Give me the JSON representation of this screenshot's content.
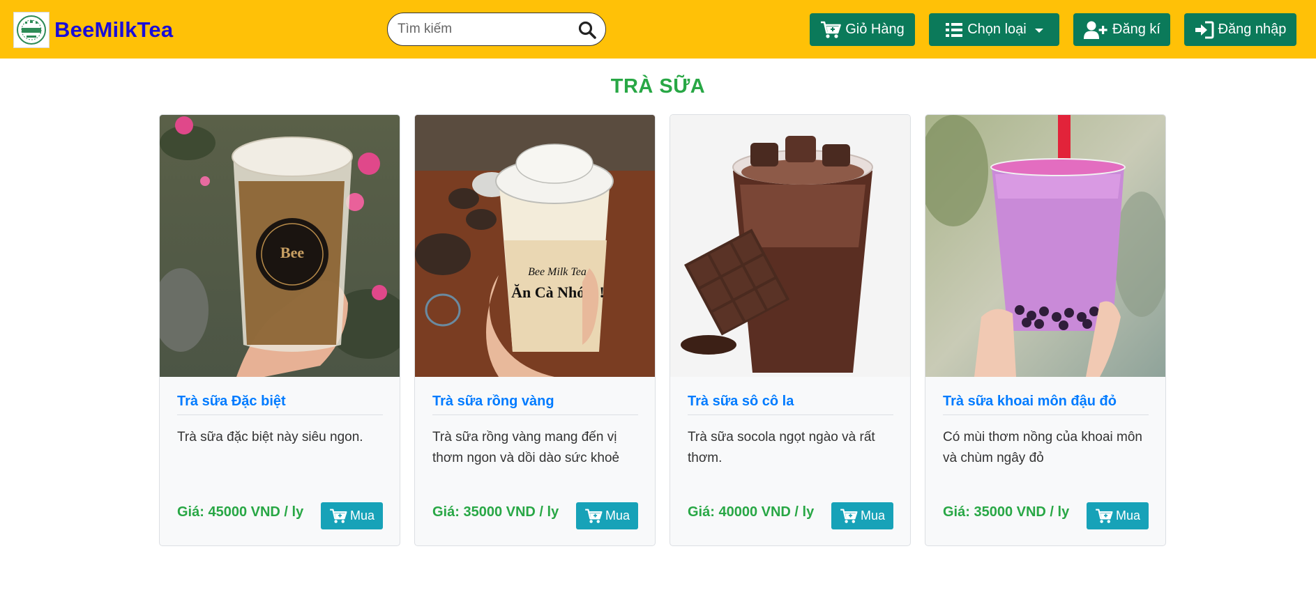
{
  "header": {
    "brand": {
      "name": "BeeMilkTea",
      "logo_icon": "bee-milk-tea-logo"
    },
    "search": {
      "placeholder": "Tìm kiếm",
      "value": "",
      "icon": "search-icon"
    },
    "buttons": {
      "cart": {
        "label": "Giỏ Hàng",
        "icon": "cart-plus-icon"
      },
      "category": {
        "label": "Chọn loại",
        "icon": "list-icon"
      },
      "register": {
        "label": "Đăng kí",
        "icon": "user-plus-icon"
      },
      "login": {
        "label": "Đăng nhập",
        "icon": "sign-in-icon"
      }
    }
  },
  "section": {
    "title": "TRÀ SỮA"
  },
  "products": [
    {
      "name": "Trà sữa Đặc biệt",
      "description": "Trà sữa đặc biệt này siêu ngon.",
      "price": "Giá: 45000 VND / ly",
      "buy_label": "Mua"
    },
    {
      "name": "Trà sữa rồng vàng",
      "description": "Trà sữa rồng vàng mang đến vị thơm ngon và dồi dào sức khoẻ",
      "price": "Giá: 35000 VND / ly",
      "buy_label": "Mua"
    },
    {
      "name": "Trà sữa sô cô la",
      "description": "Trà sữa socola ngọt ngào và rất thơm.",
      "price": "Giá: 40000 VND / ly",
      "buy_label": "Mua"
    },
    {
      "name": "Trà sữa khoai môn đậu đỏ",
      "description": "Có mùi thơm nồng của khoai môn và chùm ngây đỏ",
      "price": "Giá: 35000 VND / ly",
      "buy_label": "Mua"
    }
  ],
  "colors": {
    "navbar": "#ffc107",
    "nav_button": "#0b7a5a",
    "brand_text": "#1a0dd8",
    "title": "#28a745",
    "product_name": "#007bff",
    "price": "#28a745",
    "buy_button": "#17a2b8"
  }
}
